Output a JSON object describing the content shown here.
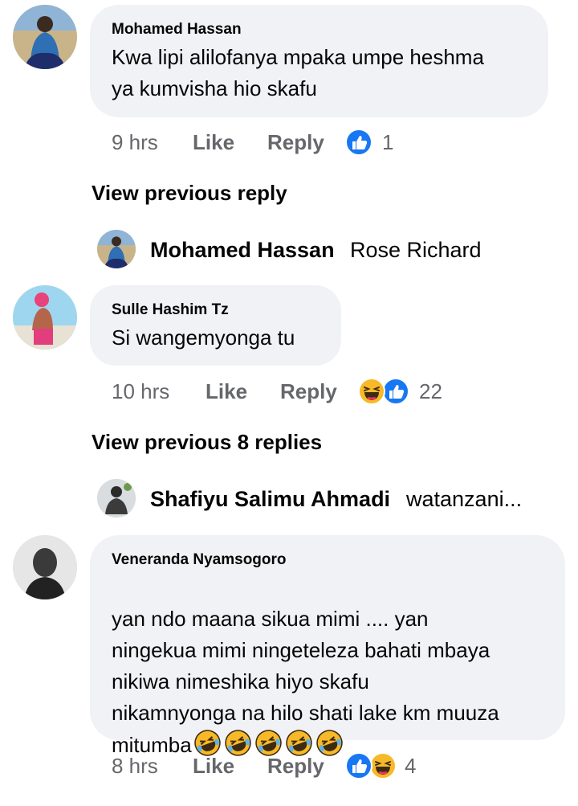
{
  "colors": {
    "bubble": "#f0f2f5",
    "meta": "#65676b",
    "text": "#050505",
    "like_blue": "#1877f2",
    "haha_yellow": "#f7b928"
  },
  "comments": [
    {
      "author": "Mohamed Hassan",
      "text": "Kwa lipi alilofanya mpaka umpe heshma\nya kumvisha hio skafu",
      "time": "9 hrs",
      "like": "Like",
      "reply": "Reply",
      "reactions": [
        "like-icon"
      ],
      "reaction_count": "1"
    },
    {
      "author": "Sulle Hashim Tz",
      "text": "Si wangemyonga tu",
      "time": "10 hrs",
      "like": "Like",
      "reply": "Reply",
      "reactions": [
        "haha-icon",
        "like-icon"
      ],
      "reaction_count": "22"
    },
    {
      "author": "Veneranda Nyamsogoro",
      "text": "yan ndo maana sikua mimi .... yan\nningekua mimi ningeteleza bahati mbaya\nnikiwa nimeshika hiyo skafu\nnikamnyonga na hilo shati lake km muuza\nmitumba",
      "emojis": [
        "rofl-emoji",
        "rofl-emoji",
        "rofl-emoji",
        "rofl-emoji",
        "rofl-emoji"
      ],
      "time": "8 hrs",
      "like": "Like",
      "reply": "Reply",
      "reactions": [
        "like-icon",
        "haha-icon"
      ],
      "reaction_count": "4"
    }
  ],
  "reply_previews": [
    {
      "view_label": "View previous reply",
      "author": "Mohamed Hassan",
      "text": "Rose Richard"
    },
    {
      "view_label": "View previous 8 replies",
      "author": "Shafiyu Salimu Ahmadi",
      "text": "watanzani..."
    }
  ]
}
